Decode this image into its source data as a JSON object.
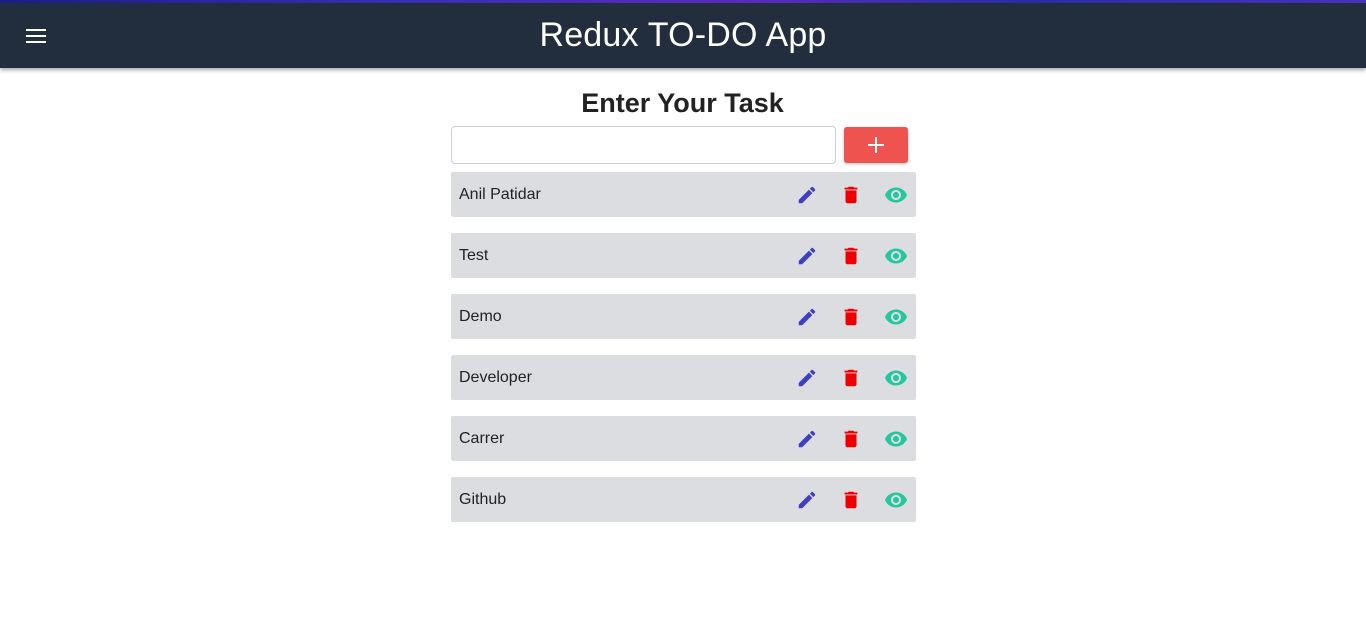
{
  "app": {
    "title": "Redux TO-DO App"
  },
  "icons": {
    "menu": "menu-icon",
    "add": "plus-icon",
    "edit": "pencil-icon",
    "delete": "trash-icon",
    "view": "eye-icon"
  },
  "colors": {
    "appbar": "#222d3d",
    "add_button": "#ef5350",
    "edit_icon": "#3f3fc4",
    "delete_icon": "#ee0000",
    "view_icon": "#26c6a0",
    "task_bg": "#dcdde0"
  },
  "form": {
    "heading": "Enter Your Task",
    "input_value": "",
    "input_placeholder": ""
  },
  "tasks": [
    {
      "label": "Anil Patidar"
    },
    {
      "label": "Test"
    },
    {
      "label": "Demo"
    },
    {
      "label": "Developer"
    },
    {
      "label": "Carrer"
    },
    {
      "label": "Github"
    }
  ]
}
